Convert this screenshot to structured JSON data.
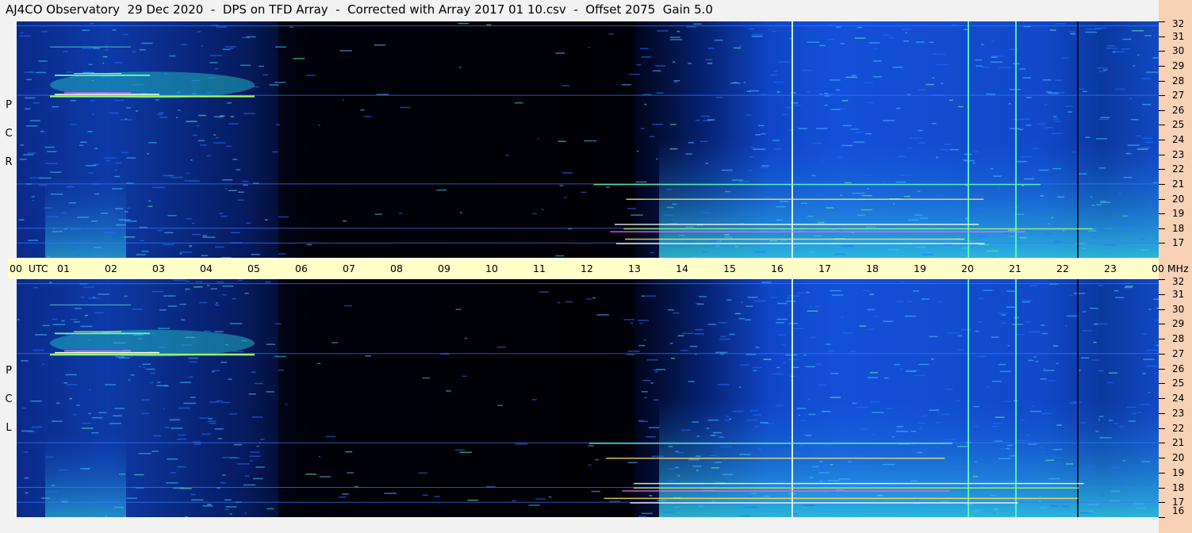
{
  "header": {
    "title": "AJ4CO Observatory  29 Dec 2020  -  DPS on TFD Array  -  Corrected with Array 2017 01 10.csv  -  Offset 2075  Gain 5.0"
  },
  "colors": {
    "background": "#f2f2f2",
    "time_axis_band": "#ffffc8",
    "freq_axis_band": "#f7d2b6",
    "spectrogram_low": "#00001a",
    "spectrogram_mid": "#1a50e0",
    "spectrogram_high": "#40e0e0",
    "spectrogram_peak": "#ffffff"
  },
  "chart_data": {
    "type": "heatmap",
    "panels": [
      {
        "name": "R C P",
        "letters": [
          "R",
          "C",
          "P"
        ]
      },
      {
        "name": "L C P",
        "letters": [
          "L",
          "C",
          "P"
        ]
      }
    ],
    "x_axis": {
      "unit": "UTC",
      "range": [
        0,
        24
      ],
      "tick_labels": [
        "00",
        "01",
        "02",
        "03",
        "04",
        "05",
        "06",
        "07",
        "08",
        "09",
        "10",
        "11",
        "12",
        "13",
        "14",
        "15",
        "16",
        "17",
        "18",
        "19",
        "20",
        "21",
        "22",
        "23",
        "00"
      ],
      "first_label": "00  UTC"
    },
    "y_axis": {
      "unit": "MHz",
      "range": [
        16,
        32
      ],
      "tick_labels": [
        "32",
        "31",
        "30",
        "29",
        "28",
        "27",
        "26",
        "25",
        "24",
        "23",
        "22",
        "21",
        "20",
        "19",
        "18",
        "17",
        "16"
      ],
      "bottom_label_top_panel": "00 MHz"
    },
    "features": {
      "night_quiet_period_utc": [
        5.5,
        13.0
      ],
      "jupiter_burst_utc": [
        0.7,
        5.0
      ],
      "jupiter_burst_mhz": [
        26.8,
        28.6
      ],
      "vertical_interference_utc": [
        16.3,
        20.0,
        21.0,
        22.3
      ],
      "horizontal_interference_mhz": [
        31.7,
        27.0,
        21.0,
        18.0,
        17.0
      ]
    }
  }
}
